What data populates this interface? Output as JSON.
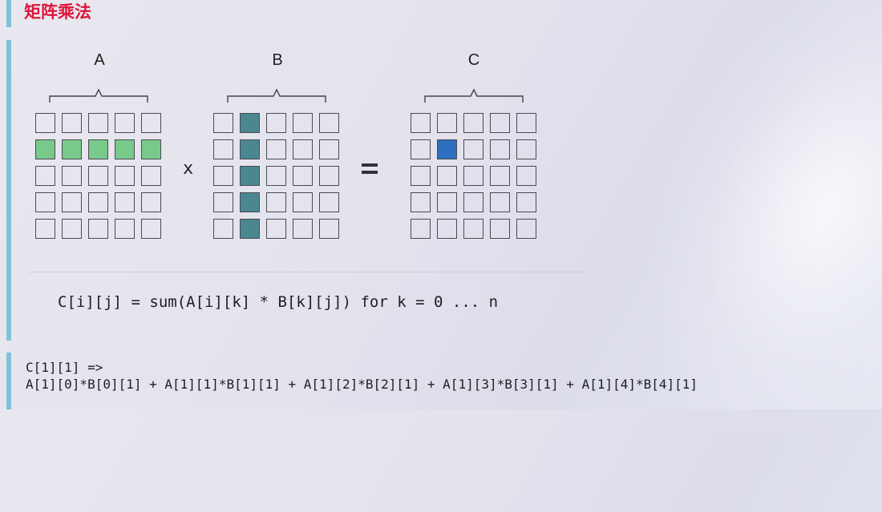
{
  "title": "矩阵乘法",
  "matrices": [
    {
      "label": "A",
      "highlight": {
        "type": "row",
        "index": 1,
        "color": "#79c98a"
      }
    },
    {
      "label": "B",
      "highlight": {
        "type": "column",
        "index": 1,
        "color": "#4b8790"
      }
    },
    {
      "label": "C",
      "highlight": {
        "type": "cell",
        "row": 1,
        "col": 1,
        "color": "#2f6fc0"
      }
    }
  ],
  "grid_size": 5,
  "operators": {
    "multiply": "x",
    "equals": "="
  },
  "formula": "C[i][j] = sum(A[i][k] * B[k][j]) for k = 0 ... n",
  "expansion": {
    "head": "C[1][1] =>",
    "body": "A[1][0]*B[0][1] + A[1][1]*B[1][1] + A[1][2]*B[2][1] + A[1][3]*B[3][1] + A[1][4]*B[4][1]"
  },
  "colors": {
    "title": "#e0143c",
    "accent_bar": "#7fc2d8",
    "cell_border": "#4a4a52"
  }
}
